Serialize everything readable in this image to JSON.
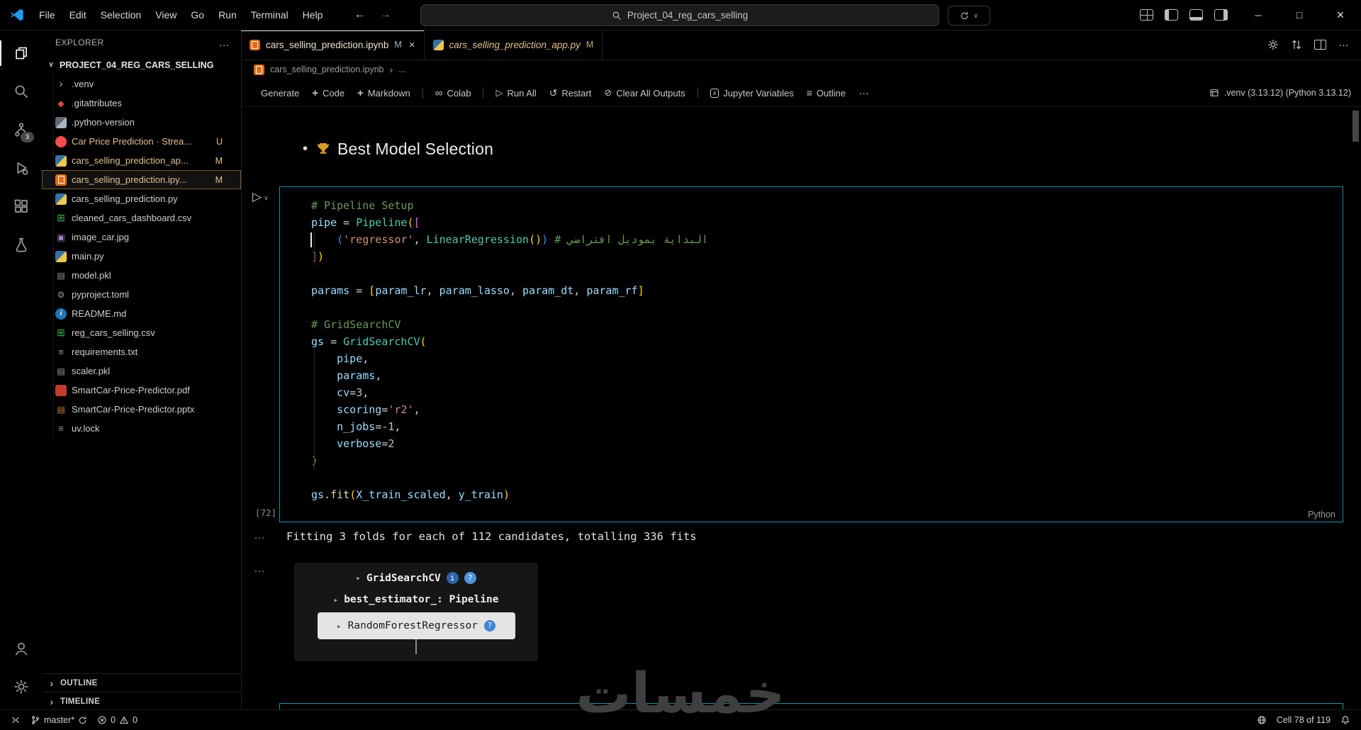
{
  "titlebar": {
    "menus": [
      "File",
      "Edit",
      "Selection",
      "View",
      "Go",
      "Run",
      "Terminal",
      "Help"
    ],
    "search_value": "Project_04_reg_cars_selling"
  },
  "activity_bar": {
    "scm_badge": "3"
  },
  "explorer": {
    "title": "EXPLORER",
    "project": "PROJECT_04_REG_CARS_SELLING",
    "files": [
      {
        "name": ".venv",
        "icon": "folder",
        "kind": "folder"
      },
      {
        "name": ".gitattributes",
        "icon": "git"
      },
      {
        "name": ".python-version",
        "icon": "pyver"
      },
      {
        "name": "Car Price Prediction · Strea...",
        "icon": "streamlit",
        "badge": "U",
        "cls": "modified"
      },
      {
        "name": "cars_selling_prediction_ap...",
        "icon": "python",
        "badge": "M",
        "cls": "modified"
      },
      {
        "name": "cars_selling_prediction.ipy...",
        "icon": "notebook",
        "badge": "M",
        "cls": "modified selected"
      },
      {
        "name": "cars_selling_prediction.py",
        "icon": "python"
      },
      {
        "name": "cleaned_cars_dashboard.csv",
        "icon": "csv"
      },
      {
        "name": "image_car.jpg",
        "icon": "image"
      },
      {
        "name": "main.py",
        "icon": "python"
      },
      {
        "name": "model.pkl",
        "icon": "file"
      },
      {
        "name": "pyproject.toml",
        "icon": "toml"
      },
      {
        "name": "README.md",
        "icon": "readme"
      },
      {
        "name": "reg_cars_selling.csv",
        "icon": "csv"
      },
      {
        "name": "requirements.txt",
        "icon": "textfile"
      },
      {
        "name": "scaler.pkl",
        "icon": "file"
      },
      {
        "name": "SmartCar-Price-Predictor.pdf",
        "icon": "pdf"
      },
      {
        "name": "SmartCar-Price-Predictor.pptx",
        "icon": "ppt"
      },
      {
        "name": "uv.lock",
        "icon": "textfile"
      }
    ],
    "outline": "OUTLINE",
    "timeline": "TIMELINE"
  },
  "tabs": [
    {
      "label": "cars_selling_prediction.ipynb",
      "badge": "M",
      "icon": "notebook",
      "cls": "active",
      "close": true
    },
    {
      "label": "cars_selling_prediction_app.py",
      "badge": "M",
      "icon": "python",
      "cls": "preview"
    }
  ],
  "breadcrumb": {
    "file": "cars_selling_prediction.ipynb",
    "more": "..."
  },
  "toolbar": {
    "items": [
      {
        "label": "Generate",
        "icon": "sparkle"
      },
      {
        "label": "Code",
        "icon": "plus"
      },
      {
        "label": "Markdown",
        "icon": "plus"
      },
      {
        "sep": true
      },
      {
        "label": "Colab",
        "icon": "infinity"
      },
      {
        "sep": true
      },
      {
        "label": "Run All",
        "icon": "run"
      },
      {
        "label": "Restart",
        "icon": "restart"
      },
      {
        "label": "Clear All Outputs",
        "icon": "clear"
      },
      {
        "sep": true
      },
      {
        "label": "Jupyter Variables",
        "icon": "variables"
      },
      {
        "label": "Outline",
        "icon": "outline"
      },
      {
        "label": "",
        "icon": "more"
      }
    ],
    "kernel": ".venv (3.13.12) (Python 3.13.12)"
  },
  "notebook": {
    "markdown_heading": "Best Model Selection",
    "execution_count": "[72]",
    "cell_language": "Python",
    "code_lines": [
      [
        {
          "t": "# Pipeline Setup",
          "c": "com"
        }
      ],
      [
        {
          "t": "pipe",
          "c": "var"
        },
        {
          "t": " = ",
          "c": "op"
        },
        {
          "t": "Pipeline",
          "c": "cls"
        },
        {
          "t": "(",
          "c": "b1"
        },
        {
          "t": "[",
          "c": "b2"
        }
      ],
      [
        {
          "t": "    ",
          "c": "pln"
        },
        {
          "t": "(",
          "c": "b3"
        },
        {
          "t": "'regressor'",
          "c": "str"
        },
        {
          "t": ", ",
          "c": "pln"
        },
        {
          "t": "LinearRegression",
          "c": "cls"
        },
        {
          "t": "(",
          "c": "b1"
        },
        {
          "t": ")",
          "c": "b1"
        },
        {
          "t": ")",
          "c": "b3"
        },
        {
          "t": " ",
          "c": "pln"
        },
        {
          "t": "# البداية بموديل افتراضي",
          "c": "com"
        }
      ],
      [
        {
          "t": "]",
          "c": "b2"
        },
        {
          "t": ")",
          "c": "b1"
        }
      ],
      [],
      [
        {
          "t": "params",
          "c": "var"
        },
        {
          "t": " = ",
          "c": "op"
        },
        {
          "t": "[",
          "c": "b1"
        },
        {
          "t": "param_lr",
          "c": "var"
        },
        {
          "t": ", ",
          "c": "pln"
        },
        {
          "t": "param_lasso",
          "c": "var"
        },
        {
          "t": ", ",
          "c": "pln"
        },
        {
          "t": "param_dt",
          "c": "var"
        },
        {
          "t": ", ",
          "c": "pln"
        },
        {
          "t": "param_rf",
          "c": "var"
        },
        {
          "t": "]",
          "c": "b1"
        }
      ],
      [],
      [
        {
          "t": "# GridSearchCV",
          "c": "com"
        }
      ],
      [
        {
          "t": "gs",
          "c": "var"
        },
        {
          "t": " = ",
          "c": "op"
        },
        {
          "t": "GridSearchCV",
          "c": "cls"
        },
        {
          "t": "(",
          "c": "b1"
        }
      ],
      [
        {
          "t": "    ",
          "c": "pln"
        },
        {
          "t": "pipe",
          "c": "var"
        },
        {
          "t": ",",
          "c": "pln"
        }
      ],
      [
        {
          "t": "    ",
          "c": "pln"
        },
        {
          "t": "params",
          "c": "var"
        },
        {
          "t": ",",
          "c": "pln"
        }
      ],
      [
        {
          "t": "    ",
          "c": "pln"
        },
        {
          "t": "cv",
          "c": "var"
        },
        {
          "t": "=",
          "c": "op"
        },
        {
          "t": "3",
          "c": "num"
        },
        {
          "t": ",",
          "c": "pln"
        }
      ],
      [
        {
          "t": "    ",
          "c": "pln"
        },
        {
          "t": "scoring",
          "c": "var"
        },
        {
          "t": "=",
          "c": "op"
        },
        {
          "t": "'r2'",
          "c": "str"
        },
        {
          "t": ",",
          "c": "pln"
        }
      ],
      [
        {
          "t": "    ",
          "c": "pln"
        },
        {
          "t": "n_jobs",
          "c": "var"
        },
        {
          "t": "=",
          "c": "op"
        },
        {
          "t": "-1",
          "c": "num"
        },
        {
          "t": ",",
          "c": "pln"
        }
      ],
      [
        {
          "t": "    ",
          "c": "pln"
        },
        {
          "t": "verbose",
          "c": "var"
        },
        {
          "t": "=",
          "c": "op"
        },
        {
          "t": "2",
          "c": "num"
        }
      ],
      [
        {
          "t": ")",
          "c": "b1"
        }
      ],
      [],
      [
        {
          "t": "gs",
          "c": "var"
        },
        {
          "t": ".",
          "c": "pln"
        },
        {
          "t": "fit",
          "c": "fn"
        },
        {
          "t": "(",
          "c": "b1"
        },
        {
          "t": "X_train_scaled",
          "c": "var"
        },
        {
          "t": ", ",
          "c": "pln"
        },
        {
          "t": "y_train",
          "c": "var"
        },
        {
          "t": ")",
          "c": "b1"
        }
      ]
    ],
    "output_text": "Fitting 3 folds for each of 112 candidates, totalling 336 fits",
    "widget": {
      "title": "GridSearchCV",
      "info_badge": "i",
      "help_badge": "?",
      "estimator": "best_estimator_: Pipeline",
      "model": "RandomForestRegressor",
      "model_help": "?"
    }
  },
  "statusbar": {
    "branch": "master*",
    "errors": "0",
    "warnings": "0",
    "cell_position": "Cell 78 of 119"
  },
  "watermark": "خمسات"
}
